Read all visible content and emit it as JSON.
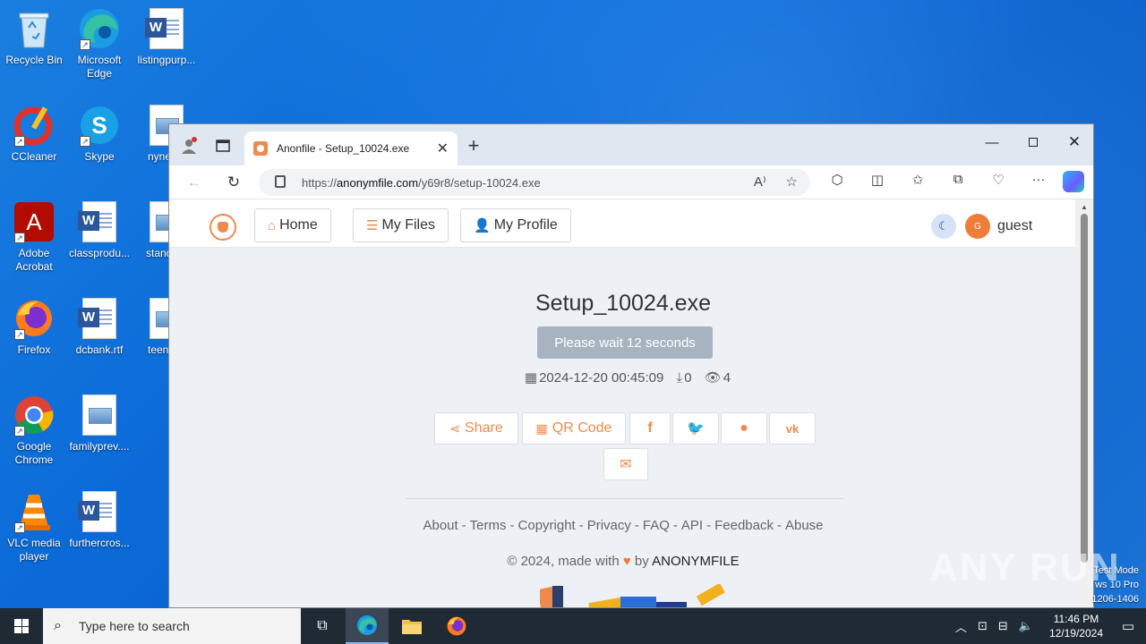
{
  "desktop": {
    "icons": [
      {
        "label": "Recycle Bin"
      },
      {
        "label": "Microsoft Edge"
      },
      {
        "label": "listingpurp..."
      },
      {
        "label": "CCleaner"
      },
      {
        "label": "Skype"
      },
      {
        "label": "nynex..."
      },
      {
        "label": "Adobe Acrobat"
      },
      {
        "label": "classprodu..."
      },
      {
        "label": "standb..."
      },
      {
        "label": "Firefox"
      },
      {
        "label": "dcbank.rtf"
      },
      {
        "label": "teensl..."
      },
      {
        "label": "Google Chrome"
      },
      {
        "label": "familyprev...."
      },
      {
        "label": "VLC media player"
      },
      {
        "label": "furthercros..."
      }
    ],
    "watermark": "ANY RUN",
    "activation": [
      "Test Mode",
      "ws 10 Pro",
      "1206-1406"
    ]
  },
  "browser": {
    "tab_title": "Anonfile - Setup_10024.exe",
    "url_prefix": "https://",
    "url_host": "anonymfile.com",
    "url_path": "/y69r8/setup-10024.exe"
  },
  "site": {
    "nav": {
      "home": "Home",
      "my_files": "My Files",
      "my_profile": "My Profile",
      "avatar_letter": "G",
      "username": "guest"
    },
    "file": {
      "name": "Setup_10024.exe",
      "wait_label": "Please wait 12 seconds",
      "date": "2024-12-20 00:45:09",
      "downloads": "0",
      "views": "4"
    },
    "share": {
      "share_label": "Share",
      "qr_label": "QR Code"
    },
    "footer": {
      "links": [
        "About",
        "Terms",
        "Copyright",
        "Privacy",
        "FAQ",
        "API",
        "Feedback",
        "Abuse"
      ],
      "copy_prefix": "© 2024, made with",
      "copy_by": "by",
      "brand": "ANONYMFILE"
    }
  },
  "taskbar": {
    "search_placeholder": "Type here to search",
    "time": "11:46 PM",
    "date": "12/19/2024"
  },
  "colors": {
    "accent": "#f08a4b",
    "desktop_bg": "#0b6ad8",
    "taskbar_bg": "#1f2a35"
  }
}
